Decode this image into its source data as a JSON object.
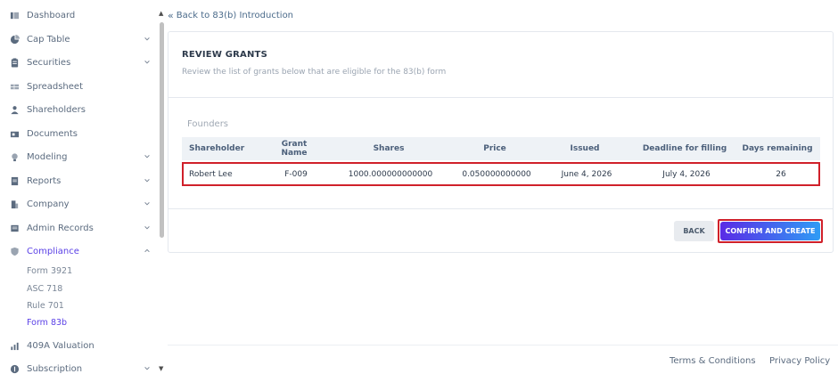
{
  "sidebar": {
    "items": [
      {
        "label": "Dashboard",
        "icon": "dashboard-icon"
      },
      {
        "label": "Cap Table",
        "icon": "pie-chart-icon"
      },
      {
        "label": "Securities",
        "icon": "clipboard-icon"
      },
      {
        "label": "Spreadsheet",
        "icon": "spreadsheet-icon"
      },
      {
        "label": "Shareholders",
        "icon": "user-icon"
      },
      {
        "label": "Documents",
        "icon": "documents-icon"
      },
      {
        "label": "Modeling",
        "icon": "bulb-icon"
      },
      {
        "label": "Reports",
        "icon": "reports-icon"
      },
      {
        "label": "Company",
        "icon": "company-icon"
      },
      {
        "label": "Admin Records",
        "icon": "admin-records-icon"
      },
      {
        "label": "Compliance",
        "icon": "shield-icon"
      },
      {
        "label": "409A Valuation",
        "icon": "valuation-icon"
      },
      {
        "label": "Subscription",
        "icon": "subscription-icon"
      }
    ],
    "compliance_sub": [
      "Form 3921",
      "ASC 718",
      "Rule 701",
      "Form 83b"
    ]
  },
  "back_link": "Back to 83(b) Introduction",
  "card": {
    "title": "REVIEW GRANTS",
    "subtitle": "Review the list of grants below that are eligible for the 83(b) form",
    "section": "Founders",
    "columns": [
      "Shareholder",
      "Grant Name",
      "Shares",
      "Price",
      "Issued",
      "Deadline for filling",
      "Days remaining"
    ],
    "rows": [
      [
        "Robert Lee",
        "F-009",
        "1000.000000000000",
        "0.050000000000",
        "June 4, 2026",
        "July 4, 2026",
        "26"
      ]
    ],
    "back_button": "BACK",
    "confirm_button": "CONFIRM AND CREATE"
  },
  "footer": {
    "terms": "Terms & Conditions",
    "privacy": "Privacy Policy"
  },
  "colors": {
    "accent": "#5a40e6",
    "highlight": "#d0202a",
    "button_gradient_start": "#5a2be6",
    "button_gradient_end": "#2f9cf5"
  }
}
